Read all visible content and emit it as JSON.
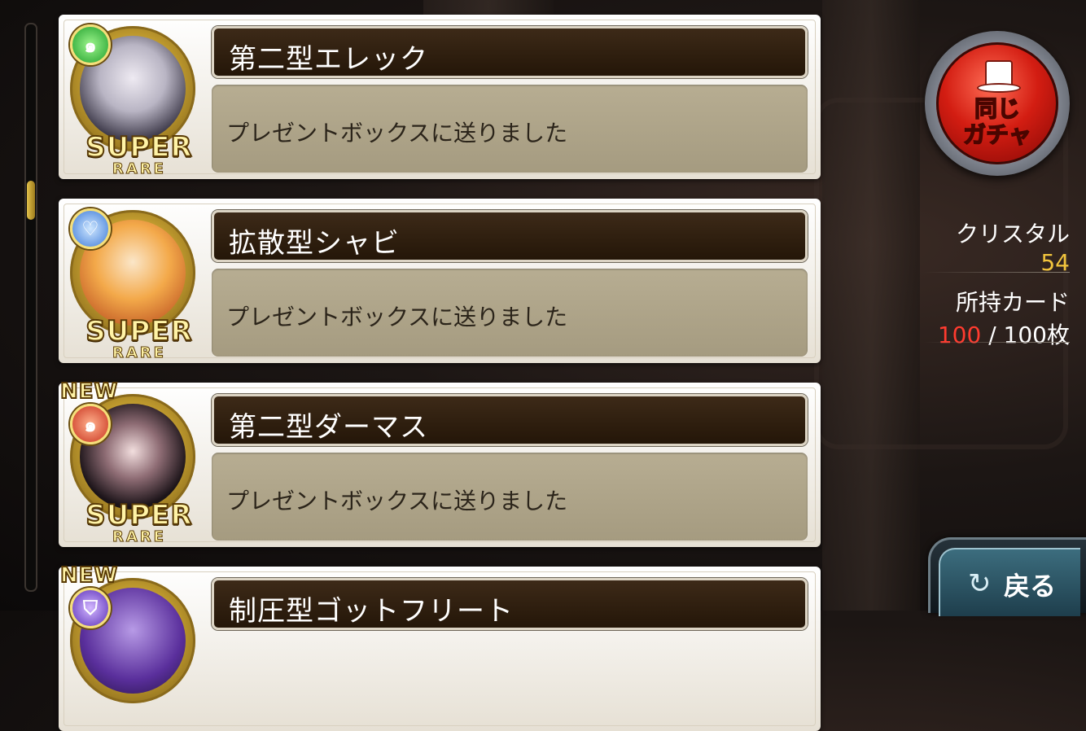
{
  "list": {
    "items": [
      {
        "name": "第二型エレック",
        "message": "プレゼントボックスに送りました",
        "rarity_top": "SUPER",
        "rarity_bottom": "RARE",
        "badge": "",
        "element_icon": "swirl-green-icon"
      },
      {
        "name": "拡散型シャビ",
        "message": "プレゼントボックスに送りました",
        "rarity_top": "SUPER",
        "rarity_bottom": "RARE",
        "badge": "",
        "element_icon": "heart-crown-blue-icon"
      },
      {
        "name": "第二型ダーマス",
        "message": "プレゼントボックスに送りました",
        "rarity_top": "SUPER",
        "rarity_bottom": "RARE",
        "badge": "NEW",
        "element_icon": "swirl-red-icon"
      },
      {
        "name": "制圧型ゴットフリート",
        "message": "",
        "rarity_top": "",
        "rarity_bottom": "",
        "badge": "NEW",
        "element_icon": "shield-purple-icon"
      }
    ]
  },
  "gacha_button": {
    "label_line1": "同じ",
    "label_line2": "ガチャ"
  },
  "stats": {
    "crystal_label": "クリスタル",
    "crystal_value": "54",
    "cards_label": "所持カード",
    "cards_current": "100",
    "cards_separator": " / ",
    "cards_max": "100枚"
  },
  "back_button": {
    "label": "戻る",
    "icon": "return-arrow-icon"
  },
  "colors": {
    "gold": "#f2c53d",
    "red": "#ff3b2f",
    "name_bar": "#2f1f10",
    "message_bg": "#ada386"
  }
}
